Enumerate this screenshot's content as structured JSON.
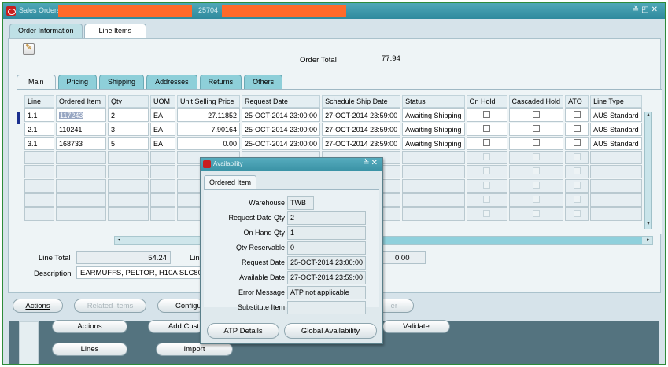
{
  "window": {
    "title": "Sales Orders",
    "title_id": "25704"
  },
  "top_tabs": [
    {
      "label": "Order Information"
    },
    {
      "label": "Line Items"
    }
  ],
  "header": {
    "order_total_label": "Order Total",
    "order_total_value": "77.94"
  },
  "sub_tabs": [
    {
      "label": "Main"
    },
    {
      "label": "Pricing"
    },
    {
      "label": "Shipping"
    },
    {
      "label": "Addresses"
    },
    {
      "label": "Returns"
    },
    {
      "label": "Others"
    }
  ],
  "grid": {
    "columns": [
      "Line",
      "Ordered Item",
      "Qty",
      "UOM",
      "Unit Selling Price",
      "Request Date",
      "Schedule Ship Date",
      "Status",
      "On Hold",
      "Cascaded Hold",
      "ATO",
      "Line Type"
    ],
    "rows": [
      {
        "line": "1.1",
        "item": "117243",
        "qty": "2",
        "uom": "EA",
        "price": "27.11852",
        "request_date": "25-OCT-2014 23:00:00",
        "ship_date": "27-OCT-2014 23:59:00",
        "status": "Awaiting Shipping",
        "line_type": "AUS Standard"
      },
      {
        "line": "2.1",
        "item": "110241",
        "qty": "3",
        "uom": "EA",
        "price": "7.90164",
        "request_date": "25-OCT-2014 23:00:00",
        "ship_date": "27-OCT-2014 23:59:00",
        "status": "Awaiting Shipping",
        "line_type": "AUS Standard"
      },
      {
        "line": "3.1",
        "item": "168733",
        "qty": "5",
        "uom": "EA",
        "price": "0.00",
        "request_date": "25-OCT-2014 23:00:00",
        "ship_date": "27-OCT-2014 23:59:00",
        "status": "Awaiting Shipping",
        "line_type": "AUS Standard"
      }
    ]
  },
  "footer": {
    "line_total_label": "Line Total",
    "line_total_value": "54.24",
    "lin_partial": "Lin",
    "tax_value": "0.00",
    "description_label": "Description",
    "description_value": "EARMUFFS, PELTOR, H10A SLC80 3"
  },
  "buttons": {
    "actions": "Actions",
    "related_items": "Related Items",
    "configure_partial": "Configu",
    "er_partial": "er"
  },
  "lower_buttons": {
    "actions": "Actions",
    "add_customer_partial": "Add Cust",
    "validate": "Validate",
    "lines": "Lines",
    "import": "Import"
  },
  "dialog": {
    "title": "Availability",
    "tab": "Ordered Item",
    "fields": [
      {
        "label": "Warehouse",
        "value": "TWB"
      },
      {
        "label": "Request Date Qty",
        "value": "2"
      },
      {
        "label": "On Hand Qty",
        "value": "1"
      },
      {
        "label": "Qty Reservable",
        "value": "0"
      },
      {
        "label": "Request Date",
        "value": "25-OCT-2014 23:00:00"
      },
      {
        "label": "Available Date",
        "value": "27-OCT-2014 23:59:00"
      },
      {
        "label": "Error Message",
        "value": "ATP not applicable"
      },
      {
        "label": "Substitute Item",
        "value": ""
      }
    ],
    "atp_details_label": "ATP Details",
    "global_availability_label": "Global Availability"
  },
  "colors": {
    "title_bar": "#3f98ab",
    "redaction": "#ff6a2a",
    "frame_border": "#2e8b3a",
    "tab_active": "#8ecfd9",
    "lower_panel": "#54737f"
  }
}
